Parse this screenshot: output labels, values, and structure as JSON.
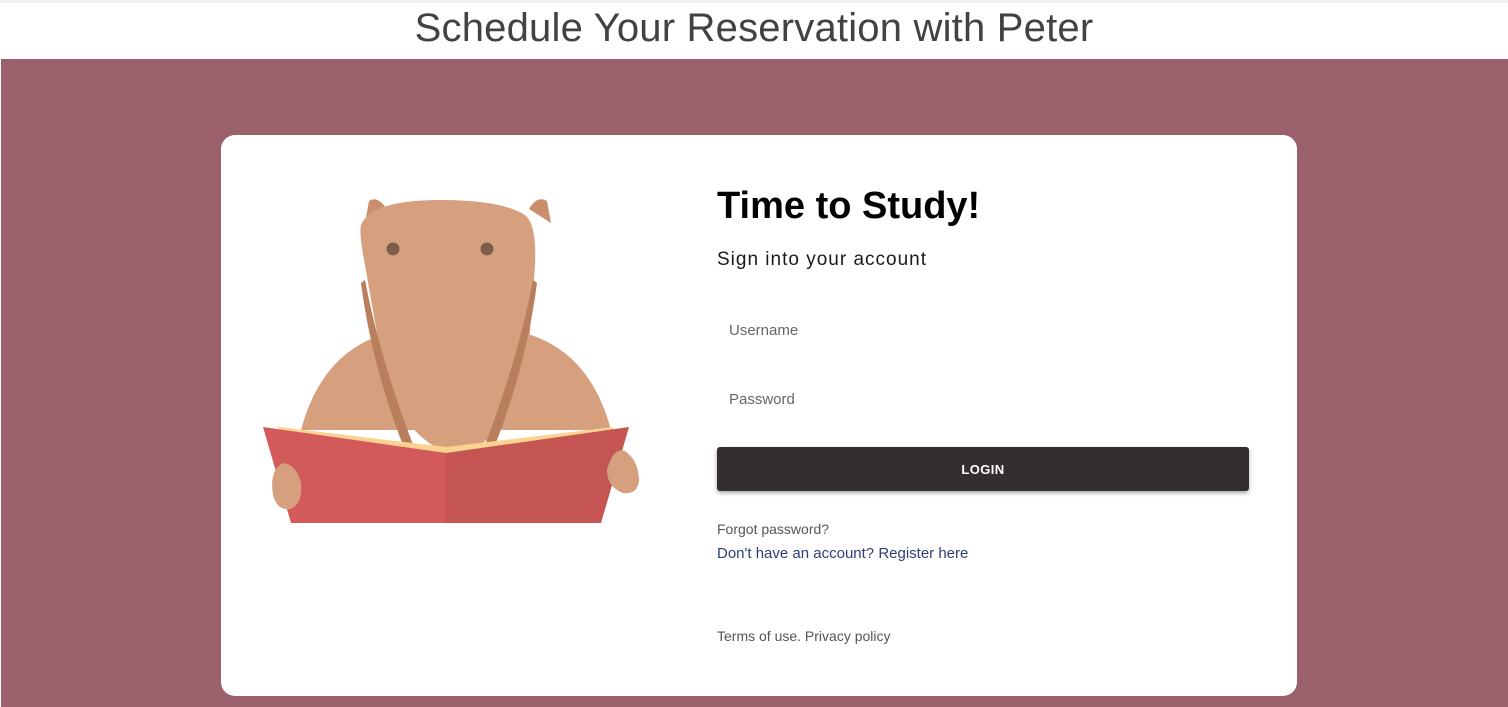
{
  "header": {
    "title": "Schedule Your Reservation with Peter"
  },
  "colors": {
    "background": "#9a606b",
    "card": "#ffffff",
    "button": "#352e2e",
    "link": "#2f3d78",
    "book_left": "#d35a5a",
    "book_right": "#c45553",
    "animal": "#d6a07e"
  },
  "login": {
    "title": "Time to Study!",
    "subtitle": "Sign into your account",
    "username_placeholder": "Username",
    "password_placeholder": "Password",
    "login_label": "LOGIN",
    "forgot_password": "Forgot password?",
    "register_prefix": "Don't have an account? ",
    "register_link": "Register here",
    "terms": "Terms of use.",
    "privacy": "Privacy policy"
  },
  "illustration": {
    "icon": "anteater-reading-book-illustration"
  }
}
